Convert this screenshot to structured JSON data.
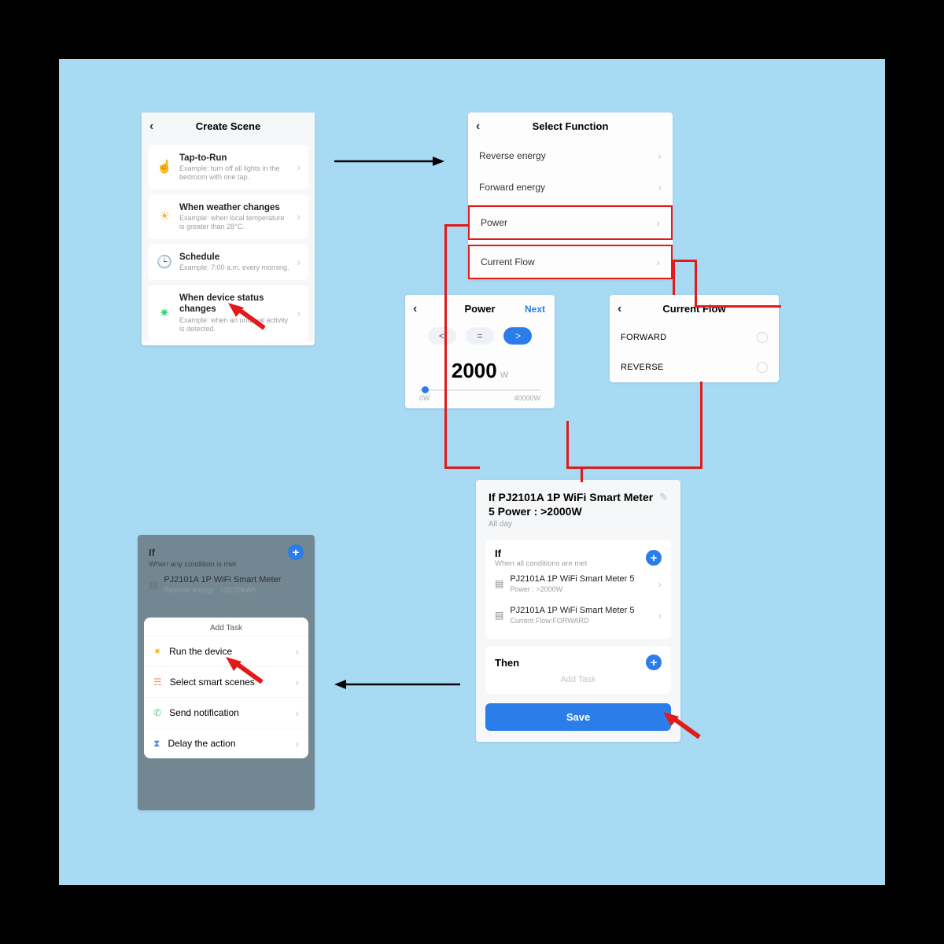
{
  "createScene": {
    "title": "Create Scene",
    "items": [
      {
        "title": "Tap-to-Run",
        "subtitle": "Example: turn off all lights in the bedroom with one tap.",
        "iconColor": "#f58b5e"
      },
      {
        "title": "When weather changes",
        "subtitle": "Example: when local temperature is greater than 28°C.",
        "iconColor": "#f7b531"
      },
      {
        "title": "Schedule",
        "subtitle": "Example: 7:00 a.m. every morning.",
        "iconColor": "#4a90e2"
      },
      {
        "title": "When device status changes",
        "subtitle": "Example: when an unusual activity is detected.",
        "iconColor": "#3fd17a"
      }
    ]
  },
  "selectFunction": {
    "title": "Select Function",
    "rows": [
      "Reverse energy",
      "Forward energy",
      "Power",
      "Current Flow"
    ]
  },
  "powerPanel": {
    "title": "Power",
    "next": "Next",
    "ops": [
      "<",
      "=",
      ">"
    ],
    "active": ">",
    "value": "2000",
    "unit": "W",
    "min": "0W",
    "max": "40000W"
  },
  "currentFlowPanel": {
    "title": "Current Flow",
    "rows": [
      "FORWARD",
      "REVERSE"
    ]
  },
  "summary": {
    "title": "If PJ2101A 1P WiFi Smart Meter  5 Power : >2000W",
    "subtitle": "All day",
    "ifLabel": "If",
    "ifSub": "When all conditions are met",
    "conditions": [
      {
        "name": "PJ2101A 1P WiFi Smart Meter 5",
        "detail": "Power : >2000W"
      },
      {
        "name": "PJ2101A 1P WiFi Smart Meter 5",
        "detail": "Current Flow:FORWARD"
      }
    ],
    "thenLabel": "Then",
    "addTask": "Add Task",
    "save": "Save"
  },
  "addTask": {
    "ifLabel": "If",
    "ifSub": "When any condition is met",
    "condName": "PJ2101A 1P WiFi Smart Meter",
    "condDetail": "Reverse energy : >10.00kWh",
    "sheetTitle": "Add Task",
    "rows": [
      {
        "label": "Run the device",
        "color": "#f7b531"
      },
      {
        "label": "Select smart scenes",
        "color": "#f58b5e"
      },
      {
        "label": "Send notification",
        "color": "#3fd17a"
      },
      {
        "label": "Delay the action",
        "color": "#4a90e2"
      }
    ]
  }
}
